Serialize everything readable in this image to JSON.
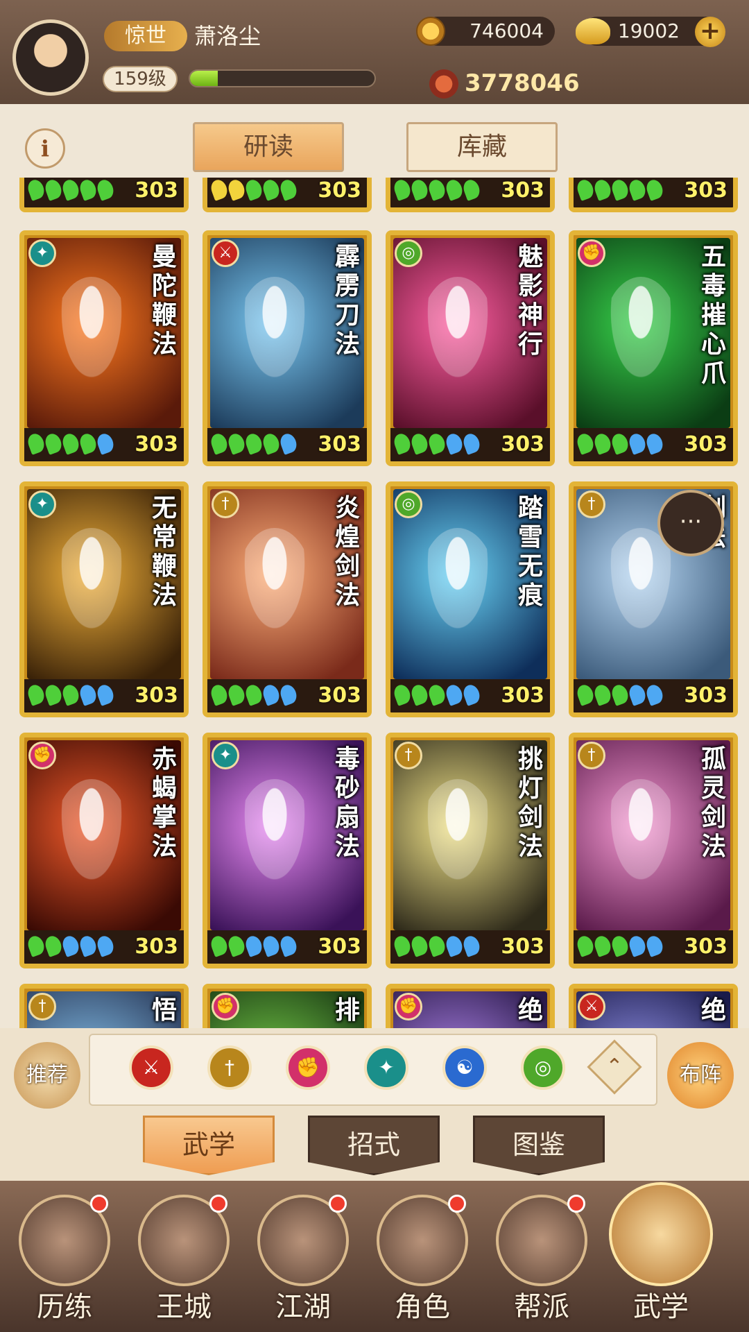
{
  "player": {
    "title_tag": "惊世",
    "name": "萧洛尘",
    "level": "159级",
    "exp_fraction": 0.15
  },
  "resources": {
    "coins": "746004",
    "ingots": "19002",
    "plus": "+",
    "power": "3778046"
  },
  "info_button": "i",
  "top_tabs": {
    "study": "研读",
    "storage": "库藏"
  },
  "colors": {
    "gold_border": "#e3b437",
    "level_text": "#fff16a"
  },
  "cards_partial_top": [
    {
      "level": "303",
      "drops": [
        "g",
        "g",
        "g",
        "g",
        "g"
      ]
    },
    {
      "level": "303",
      "drops": [
        "y",
        "y",
        "g",
        "g",
        "g"
      ]
    },
    {
      "level": "303",
      "drops": [
        "g",
        "g",
        "g",
        "g",
        "g"
      ]
    },
    {
      "level": "303",
      "drops": [
        "g",
        "g",
        "g",
        "g",
        "g"
      ]
    }
  ],
  "cards": [
    {
      "name": "曼陀鞭法",
      "level": "303",
      "school": "fan-icon",
      "art": [
        "#ff7a1f",
        "#5a1a0a"
      ],
      "drops": [
        "g",
        "g",
        "g",
        "g",
        "b"
      ]
    },
    {
      "name": "霹雳刀法",
      "level": "303",
      "school": "blade-icon",
      "art": [
        "#7ac8f2",
        "#1c3b5a"
      ],
      "drops": [
        "g",
        "g",
        "g",
        "g",
        "b"
      ]
    },
    {
      "name": "魅影神行",
      "level": "303",
      "school": "swirl-icon",
      "art": [
        "#ff5fa2",
        "#5a0f2a"
      ],
      "drops": [
        "g",
        "g",
        "g",
        "b",
        "b"
      ]
    },
    {
      "name": "五毒摧心爪",
      "level": "303",
      "school": "fist-icon",
      "art": [
        "#37d14a",
        "#0b3d14"
      ],
      "drops": [
        "g",
        "g",
        "g",
        "b",
        "b"
      ]
    },
    {
      "name": "无常鞭法",
      "level": "303",
      "school": "fan-icon",
      "art": [
        "#f2b13a",
        "#3a2208"
      ],
      "drops": [
        "g",
        "g",
        "g",
        "b",
        "b"
      ]
    },
    {
      "name": "炎煌剑法",
      "level": "303",
      "school": "sword-icon",
      "art": [
        "#ffb07a",
        "#7a2a1a"
      ],
      "drops": [
        "g",
        "g",
        "g",
        "b",
        "b"
      ]
    },
    {
      "name": "踏雪无痕",
      "level": "303",
      "school": "swirl-icon",
      "art": [
        "#6ad4f7",
        "#0e2e5a"
      ],
      "drops": [
        "g",
        "g",
        "g",
        "b",
        "b"
      ]
    },
    {
      "name": "剑法",
      "level": "303",
      "school": "sword-icon",
      "art": [
        "#b6d6f2",
        "#3b5a7a"
      ],
      "drops": [
        "g",
        "g",
        "g",
        "b",
        "b"
      ]
    },
    {
      "name": "赤蝎掌法",
      "level": "303",
      "school": "fist-icon",
      "art": [
        "#f05a2a",
        "#3a0a04"
      ],
      "drops": [
        "g",
        "g",
        "b",
        "b",
        "b"
      ]
    },
    {
      "name": "毒砂扇法",
      "level": "303",
      "school": "fan-icon",
      "art": [
        "#e88af2",
        "#3a1258"
      ],
      "drops": [
        "g",
        "g",
        "b",
        "b",
        "b"
      ]
    },
    {
      "name": "挑灯剑法",
      "level": "303",
      "school": "sword-icon",
      "art": [
        "#f2e48a",
        "#2e2a1a"
      ],
      "drops": [
        "g",
        "g",
        "g",
        "b",
        "b"
      ]
    },
    {
      "name": "孤灵剑法",
      "level": "303",
      "school": "sword-icon",
      "art": [
        "#f59ad2",
        "#5a1a4a"
      ],
      "drops": [
        "g",
        "g",
        "g",
        "b",
        "b"
      ]
    }
  ],
  "cards_partial_bottom": [
    {
      "name": "悟",
      "school": "sword-icon",
      "art": [
        "#8ac8f2",
        "#2a3a5a"
      ]
    },
    {
      "name": "排",
      "school": "fist-icon",
      "art": [
        "#7ad44a",
        "#1a3a14"
      ]
    },
    {
      "name": "绝",
      "school": "fist-icon",
      "art": [
        "#b68af2",
        "#2a1a4a"
      ]
    },
    {
      "name": "绝",
      "school": "blade-icon",
      "art": [
        "#9a9af2",
        "#1a1a4a"
      ]
    }
  ],
  "filter": {
    "recommend": "推荐",
    "formation": "布阵",
    "icons": [
      {
        "name": "blade-icon",
        "color": "#c8261f",
        "glyph": "⚔"
      },
      {
        "name": "sword-icon",
        "color": "#b8861c",
        "glyph": "†"
      },
      {
        "name": "fist-icon",
        "color": "#d2306a",
        "glyph": "✊"
      },
      {
        "name": "fan-icon",
        "color": "#1a8f8a",
        "glyph": "✦"
      },
      {
        "name": "yinyang-icon",
        "color": "#2a6ad0",
        "glyph": "☯"
      },
      {
        "name": "swirl-icon",
        "color": "#4fa82a",
        "glyph": "◎"
      }
    ]
  },
  "sub_tabs": {
    "martial": "武学",
    "moves": "招式",
    "codex": "图鉴"
  },
  "bottom_nav": [
    {
      "label": "历练",
      "dot": true
    },
    {
      "label": "王城",
      "dot": true
    },
    {
      "label": "江湖",
      "dot": true
    },
    {
      "label": "角色",
      "dot": true
    },
    {
      "label": "帮派",
      "dot": true
    },
    {
      "label": "武学",
      "dot": false,
      "active": true
    }
  ],
  "chat": "···"
}
